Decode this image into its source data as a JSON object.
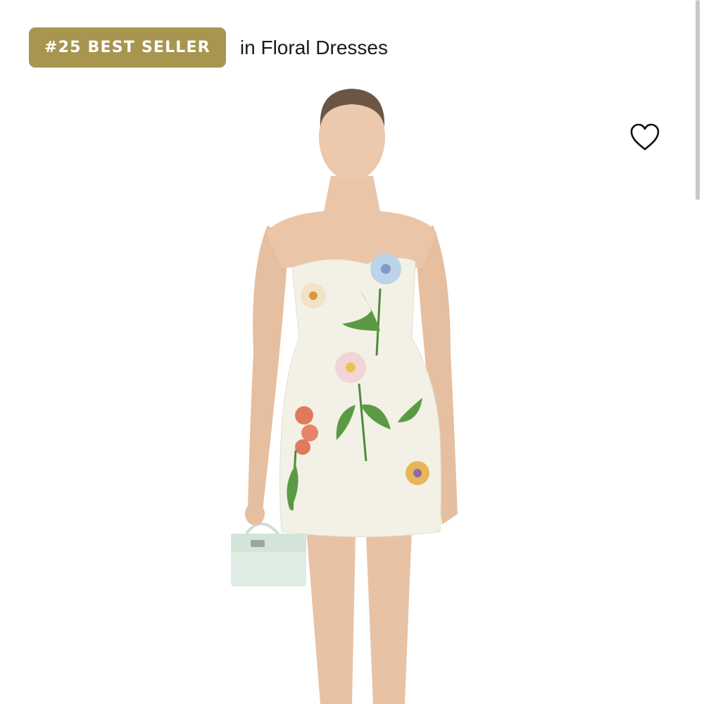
{
  "badge": {
    "rank_label": "#25 BEST SELLER",
    "context": "in Floral Dresses",
    "color": "#a89550"
  },
  "product": {
    "image_subject": "model wearing strapless white mini dress with embroidered florals, holding mint green top-handle bag"
  },
  "wishlist": {
    "icon": "heart-outline-icon"
  },
  "scrollbar": {
    "position": 0.0
  }
}
